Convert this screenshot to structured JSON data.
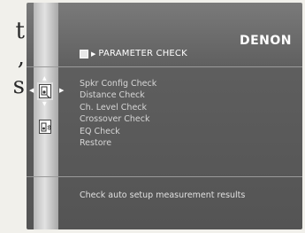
{
  "page_text": [
    "t",
    ",",
    "s"
  ],
  "brand": "DENON",
  "header": {
    "title": "PARAMETER CHECK"
  },
  "menu": [
    "Spkr Config Check",
    "Distance Check",
    "Ch. Level Check",
    "Crossover Check",
    "EQ Check",
    "Restore"
  ],
  "status_message": "Check auto setup measurement results",
  "icons": {
    "header": "parameter-icon",
    "selected_tab": "speaker-setup-icon",
    "second_tab": "speaker-volume-icon"
  }
}
